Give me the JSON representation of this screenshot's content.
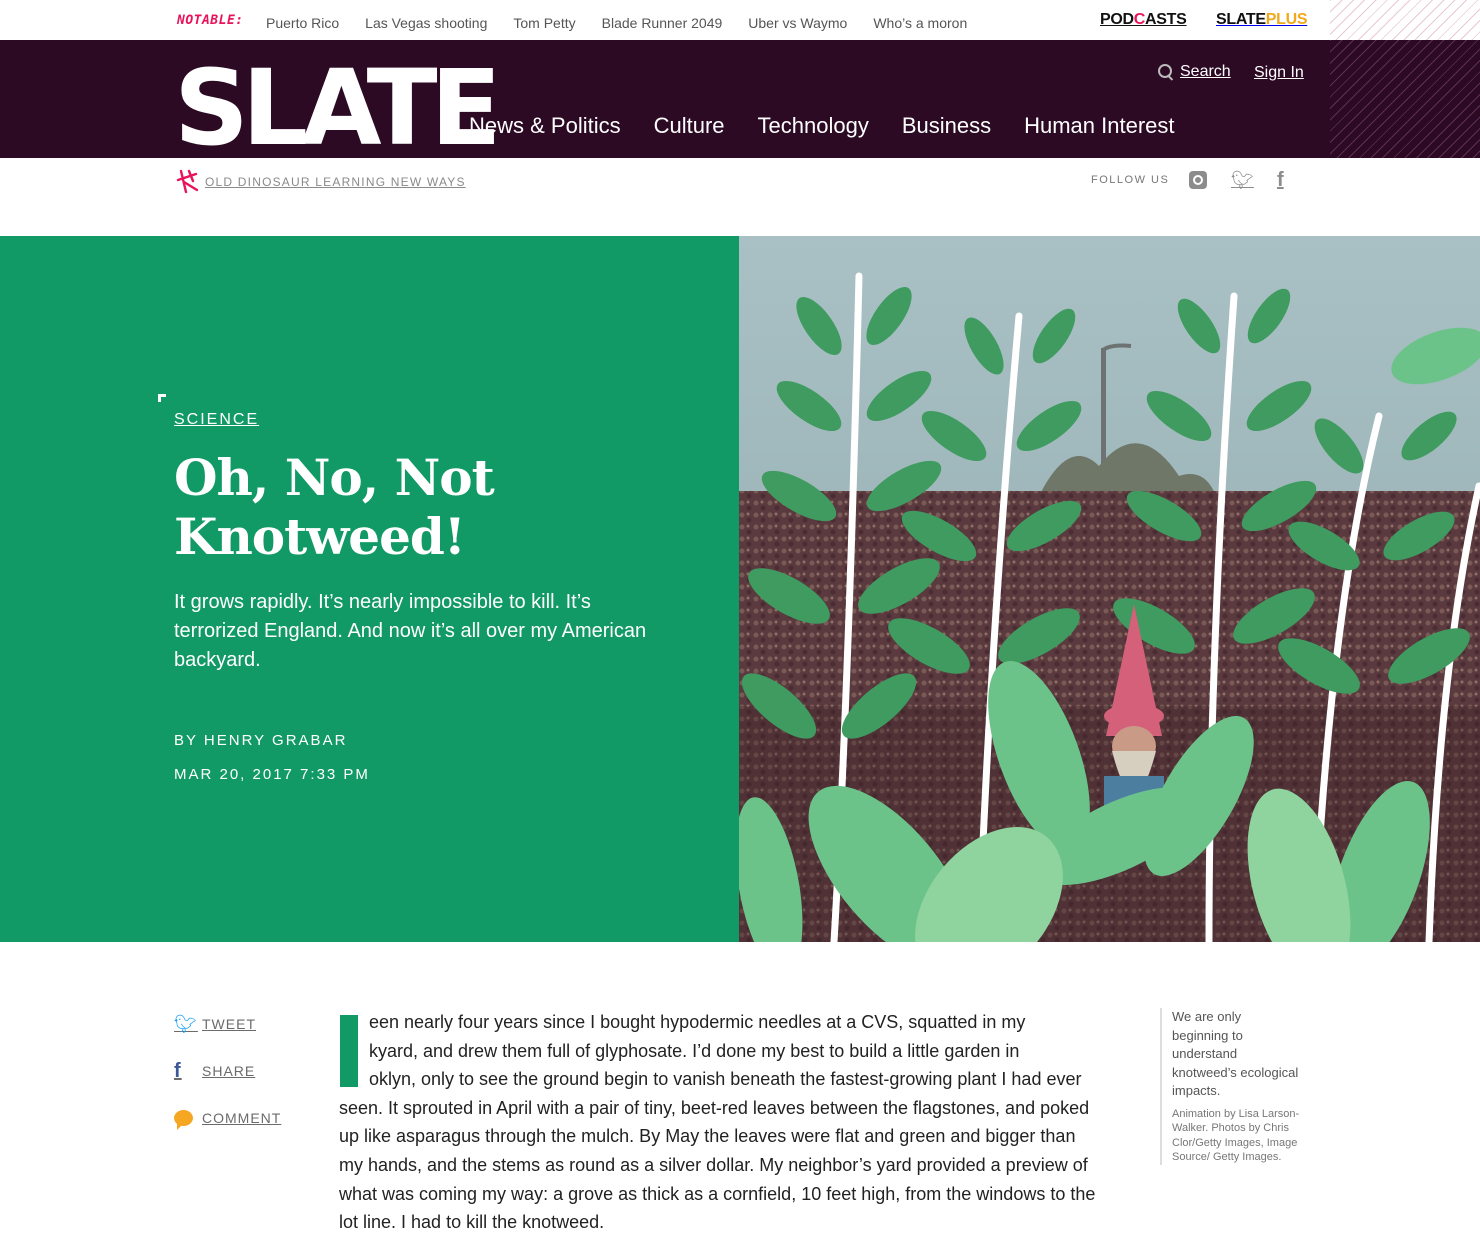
{
  "notable": {
    "label": "NOTABLE:",
    "links": [
      "Puerto Rico",
      "Las Vegas shooting",
      "Tom Petty",
      "Blade Runner 2049",
      "Uber vs Waymo",
      "Who’s a moron"
    ]
  },
  "brand": {
    "podcasts_a": "POD",
    "podcasts_o": "C",
    "podcasts_b": "ASTS",
    "slateplus_a": "SLATE",
    "slateplus_b": "PLUS",
    "logo": "SLATE",
    "accent": "#2c0a24",
    "hero_green": "#129a66"
  },
  "header": {
    "search_label": "Search",
    "signin_label": "Sign In",
    "nav": [
      "News & Politics",
      "Culture",
      "Technology",
      "Business",
      "Human Interest"
    ]
  },
  "subheader": {
    "blog_name": "OLD DINOSAUR LEARNING NEW WAYS",
    "follow_label": "FOLLOW US",
    "icons": [
      "instagram-icon",
      "twitter-icon",
      "facebook-icon"
    ]
  },
  "article": {
    "section": "SCIENCE",
    "headline": "Oh, No, Not Knotweed!",
    "dek": "It grows rapidly. It’s nearly impossible to kill. It’s terrorized England. And now it’s all over my American backyard.",
    "by_label": "BY",
    "author": "HENRY GRABAR",
    "date": "MAR 20, 2017 7:33 PM",
    "body_lines": [
      "een nearly four years since I bought hypodermic needles at a CVS, squatted in my",
      "kyard, and drew them full of glyphosate. I’d done my best to build a little garden in",
      "oklyn, only to see the ground begin to vanish beneath the fastest-growing plant I had ever",
      "seen. It sprouted in April with a pair of tiny, beet-red leaves between the flagstones, and poked",
      "up like asparagus through the mulch. By May the leaves were flat and green and bigger than",
      "my hands, and the stems as round as a silver dollar. My neighbor’s yard provided a preview of",
      "what was coming my way: a grove as thick as a cornfield, 10 feet high, from the windows to the",
      "lot line. I had to kill the knotweed."
    ]
  },
  "share": {
    "tweet": "TWEET",
    "share": "SHARE",
    "comment": "COMMENT"
  },
  "aside": {
    "caption": "We are only beginning to understand knotweed’s ecological impacts.",
    "credit": "Animation by Lisa Larson-Walker. Photos by Chris Clor/Getty Images, Image Source/ Getty Images."
  }
}
